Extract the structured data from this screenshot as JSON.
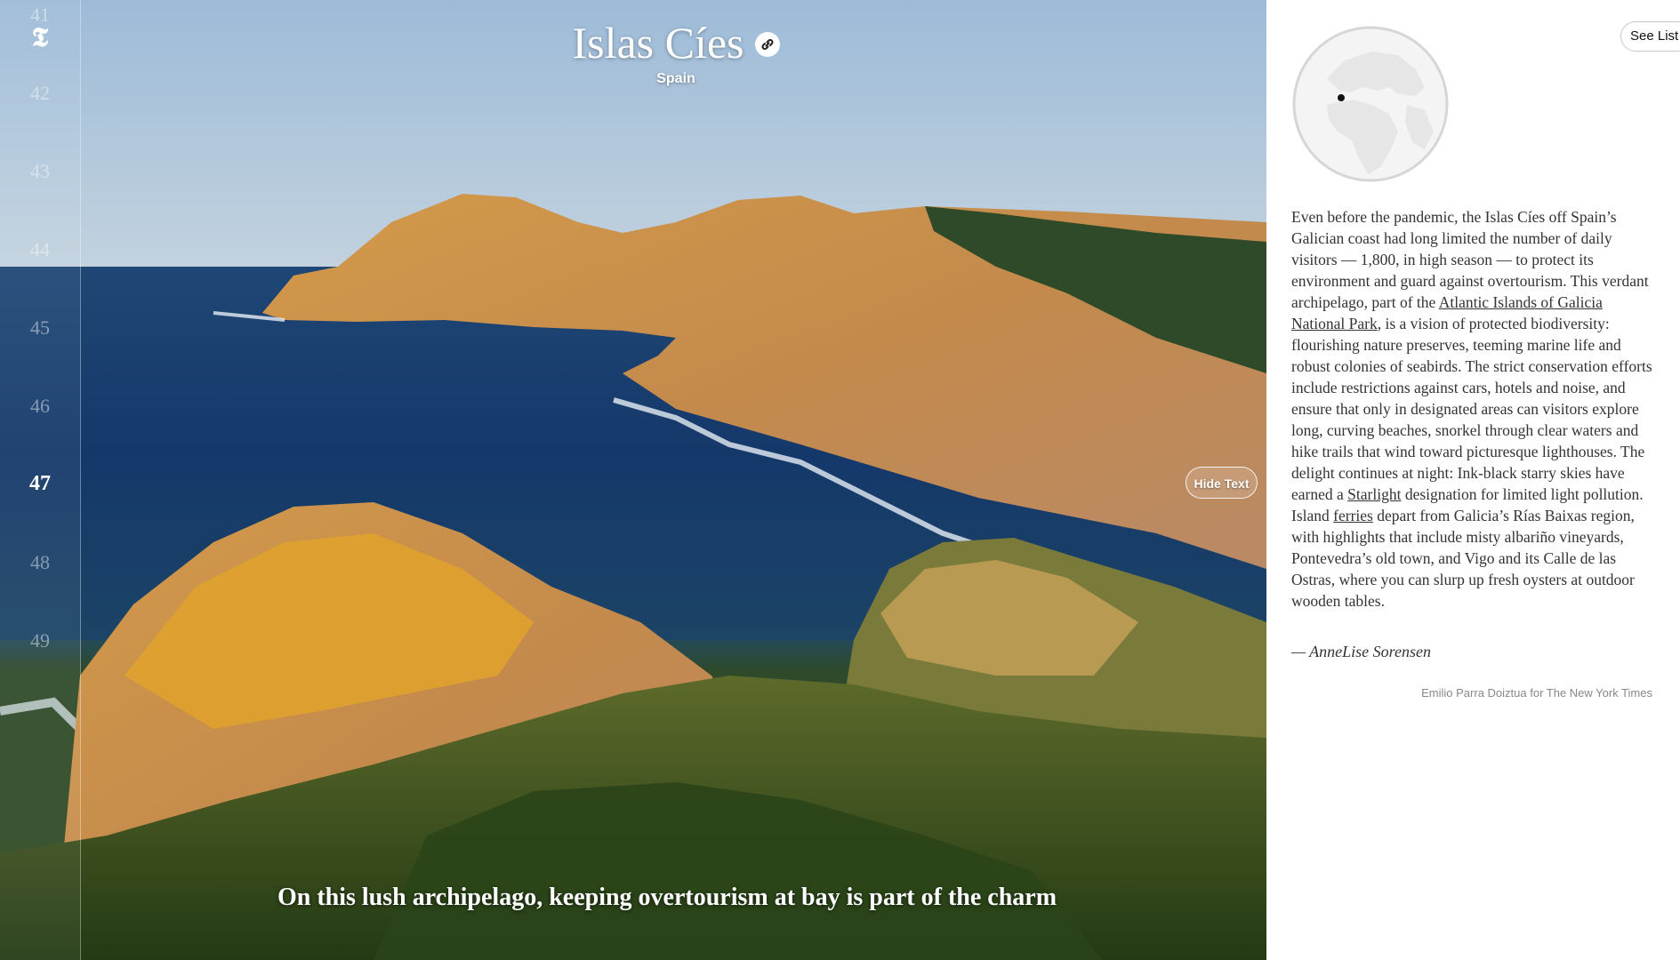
{
  "rail": {
    "numbers": [
      "41",
      "42",
      "43",
      "44",
      "45",
      "46",
      "47",
      "48",
      "49"
    ],
    "active": "47"
  },
  "hero": {
    "title": "Islas Cíes",
    "subtitle": "Spain",
    "caption": "On this lush archipelago, keeping overtourism at bay is part of the charm",
    "hide_text_label": "Hide Text"
  },
  "panel": {
    "see_list_label": "See List",
    "body_before_link1": "Even before the pandemic, the Islas Cíes off Spain’s Galician coast had long limited the number of daily visitors — 1,800, in high season — to protect its environment and guard against overtourism. This verdant archipelago, part of the ",
    "link1": "Atlantic Islands of Galicia National Park",
    "body_after_link1": ", is a vision of protected biodiversity: flourishing nature preserves, teeming marine life and robust colonies of seabirds. The strict conservation efforts include restrictions against cars, hotels and noise, and ensure that only in designated areas can visitors explore long, curving beaches, snorkel through clear waters and hike trails that wind toward picturesque lighthouses. The delight continues at night: Ink-black starry skies have earned a ",
    "link2": "Starlight",
    "body_after_link2": " designation for limited light pollution. Island ",
    "link3": "ferries",
    "body_after_link3": " depart from Galicia’s Rías Baixas region, with highlights that include misty albariño vineyards, Pontevedra’s old town, and Vigo and its Calle de las Ostras, where you can slurp up fresh oysters at outdoor wooden tables.",
    "author": "— AnneLise Sorensen",
    "credit": "Emilio Parra Doiztua for The New York Times"
  },
  "colors": {
    "sea": "#173a68",
    "rock": "#c9924a",
    "lichen": "#e0a22c",
    "vegetation": "#3a5a22",
    "sky": "#a9c1d8"
  },
  "icons": {
    "logo": "nyt-logo-icon",
    "link": "link-icon",
    "globe": "globe-icon",
    "location": "location-dot-icon"
  }
}
